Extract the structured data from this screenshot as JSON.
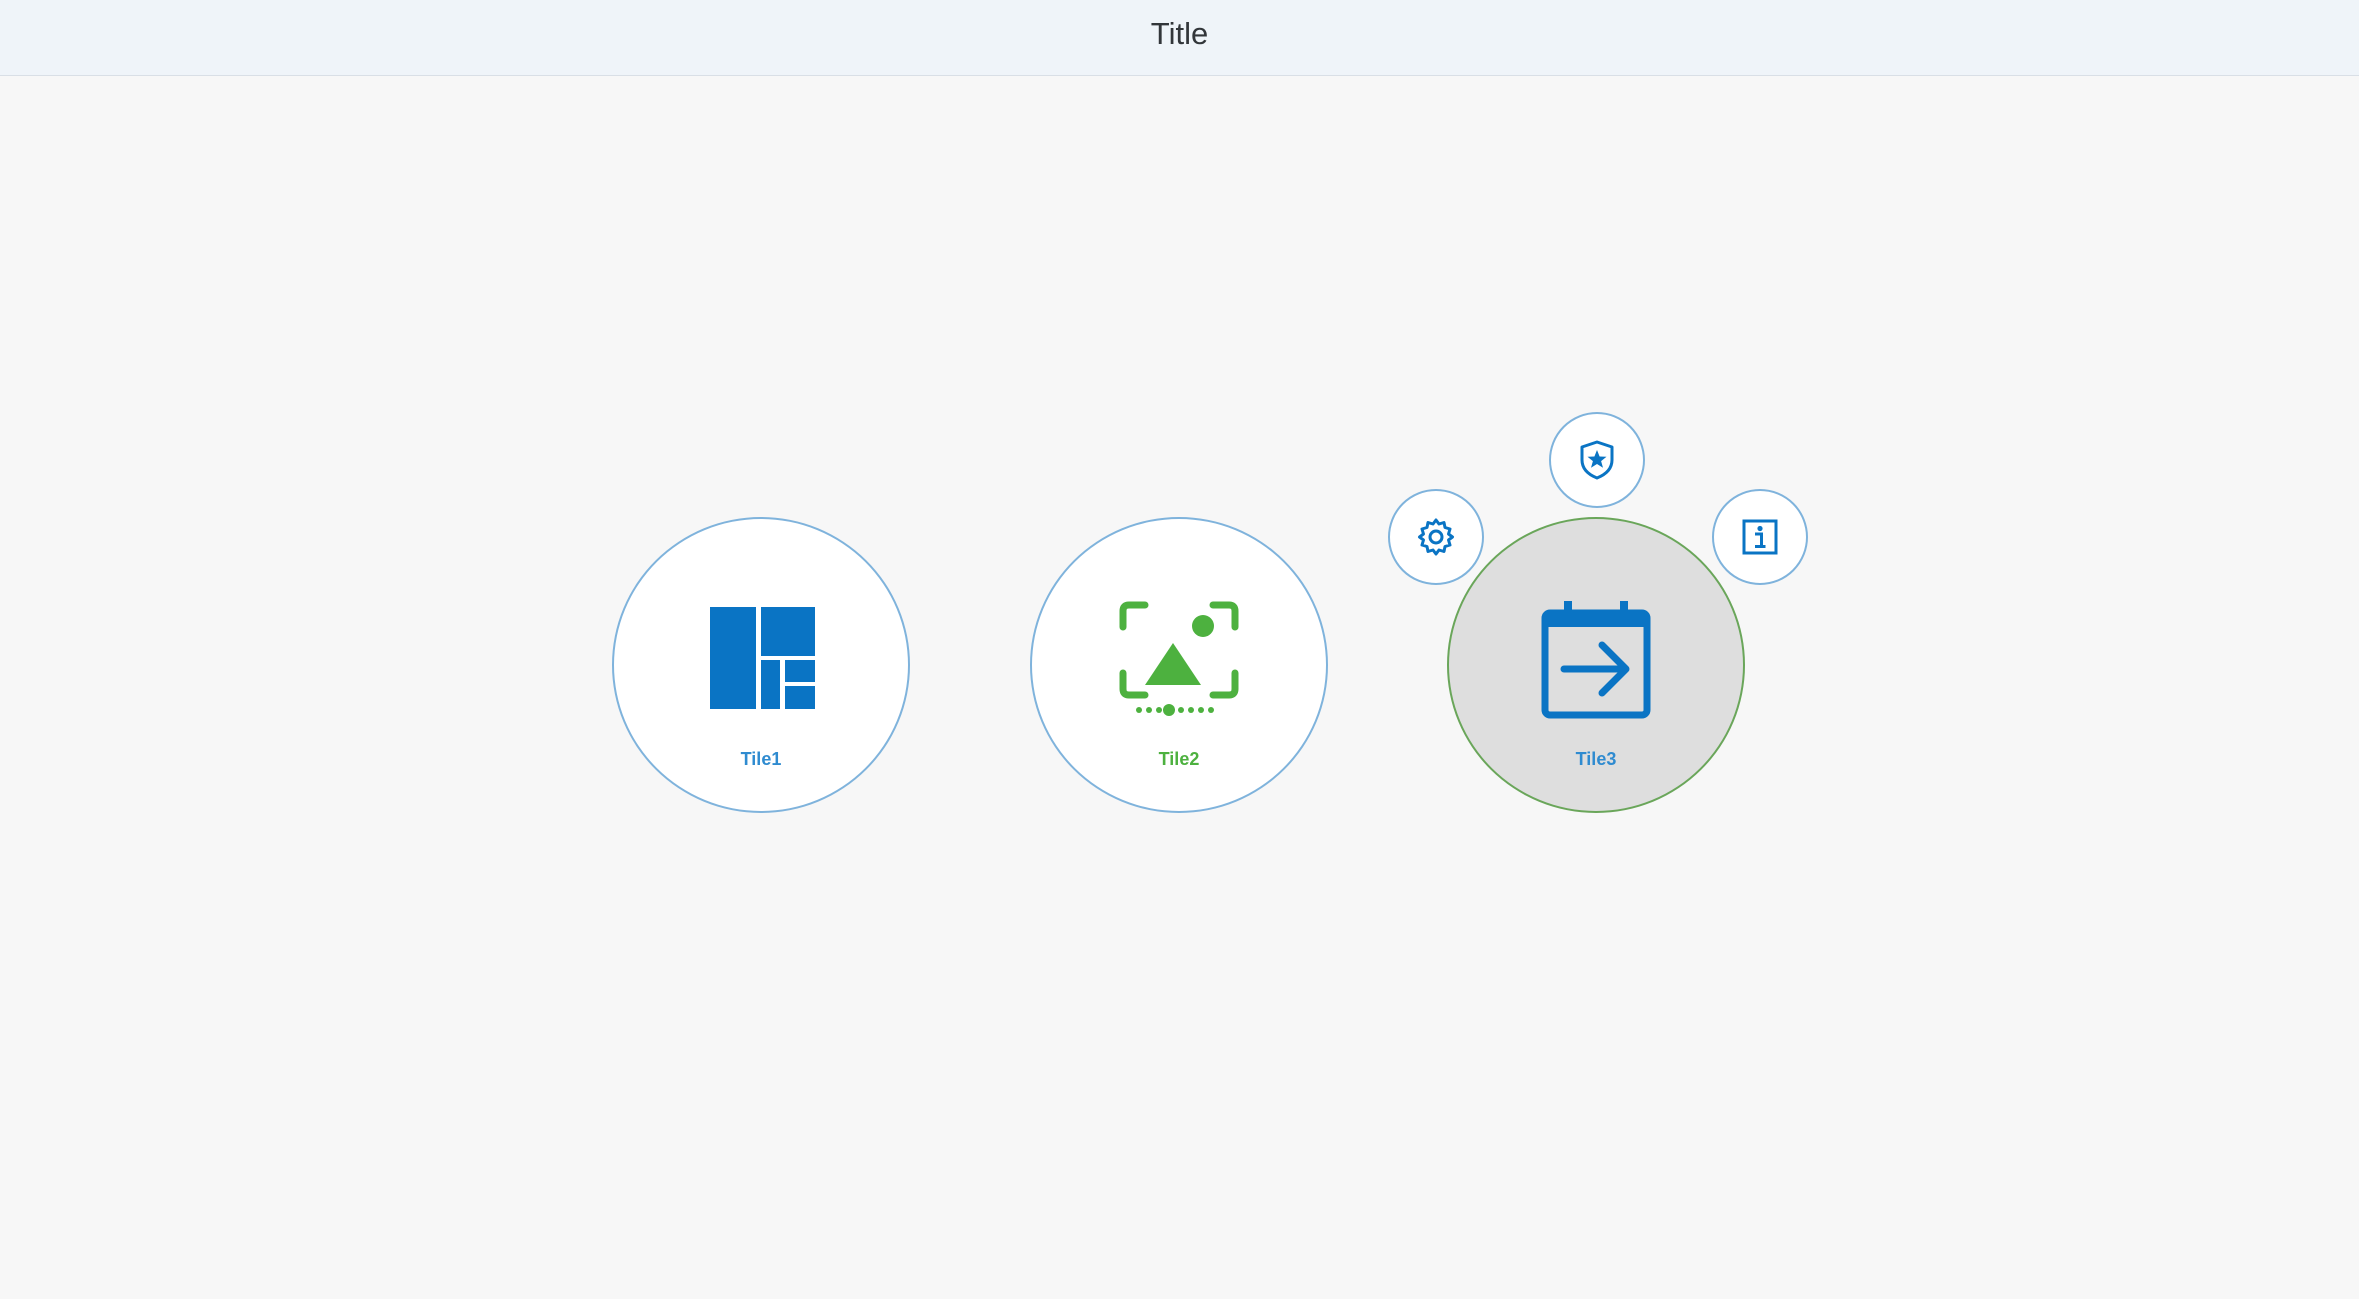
{
  "header": {
    "title": "Title"
  },
  "tiles": [
    {
      "label": "Tile1",
      "icon": "layout-grid-icon",
      "label_color": "#2f8bd0",
      "icon_color": "#0a74c4"
    },
    {
      "label": "Tile2",
      "icon": "image-scan-icon",
      "label_color": "#4db13f",
      "icon_color": "#4db13f"
    },
    {
      "label": "Tile3",
      "icon": "calendar-arrow-icon",
      "label_color": "#2f8bd0",
      "icon_color": "#0a74c4",
      "selected": true
    }
  ],
  "tile_actions": {
    "icons": [
      "gear-icon",
      "shield-star-icon",
      "info-icon"
    ],
    "color": "#0a74c4"
  },
  "colors": {
    "header_background": "#eff4f9",
    "page_background": "#f7f7f7",
    "tile_border": "#7fb3dc",
    "selected_tile_border": "#6aa65a",
    "selected_tile_background": "#dedede"
  }
}
